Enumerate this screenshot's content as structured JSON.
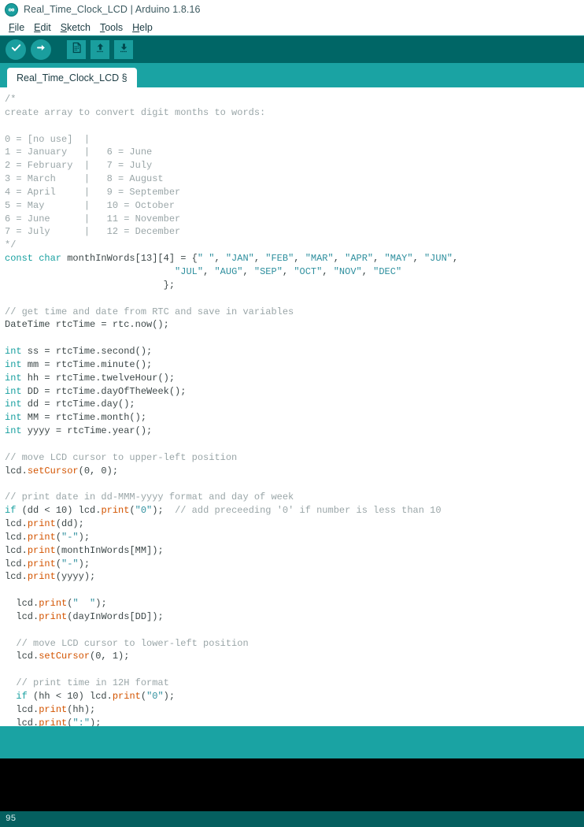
{
  "window": {
    "title": "Real_Time_Clock_LCD | Arduino 1.8.16",
    "logo_icon": "arduino-infinity-logo"
  },
  "menubar": {
    "items": [
      {
        "label": "File",
        "mnemonic": "F"
      },
      {
        "label": "Edit",
        "mnemonic": "E"
      },
      {
        "label": "Sketch",
        "mnemonic": "S"
      },
      {
        "label": "Tools",
        "mnemonic": "T"
      },
      {
        "label": "Help",
        "mnemonic": "H"
      }
    ]
  },
  "toolbar": {
    "buttons": [
      {
        "name": "verify-button",
        "icon": "checkmark-icon",
        "tooltip": "Verify"
      },
      {
        "name": "upload-button",
        "icon": "arrow-right-icon",
        "tooltip": "Upload"
      },
      {
        "name": "new-sketch-button",
        "icon": "new-file-icon",
        "tooltip": "New"
      },
      {
        "name": "open-sketch-button",
        "icon": "arrow-up-icon",
        "tooltip": "Open"
      },
      {
        "name": "save-sketch-button",
        "icon": "arrow-down-icon",
        "tooltip": "Save"
      }
    ]
  },
  "tabs": [
    {
      "label": "Real_Time_Clock_LCD §",
      "active": true
    }
  ],
  "editor": {
    "lines": [
      [
        {
          "t": "/*",
          "c": "cm"
        }
      ],
      [
        {
          "t": "create array to convert digit months to words:",
          "c": "cm"
        }
      ],
      [
        {
          "t": "",
          "c": "cm"
        }
      ],
      [
        {
          "t": "0 = [no use]  |",
          "c": "cm"
        }
      ],
      [
        {
          "t": "1 = January   |   6 = June",
          "c": "cm"
        }
      ],
      [
        {
          "t": "2 = February  |   7 = July",
          "c": "cm"
        }
      ],
      [
        {
          "t": "3 = March     |   8 = August",
          "c": "cm"
        }
      ],
      [
        {
          "t": "4 = April     |   9 = September",
          "c": "cm"
        }
      ],
      [
        {
          "t": "5 = May       |   10 = October",
          "c": "cm"
        }
      ],
      [
        {
          "t": "6 = June      |   11 = November",
          "c": "cm"
        }
      ],
      [
        {
          "t": "7 = July      |   12 = December",
          "c": "cm"
        }
      ],
      [
        {
          "t": "*/",
          "c": "cm"
        }
      ],
      [
        {
          "t": "const char",
          "c": "kw"
        },
        {
          "t": " monthInWords[13][4] = {",
          "c": "pl"
        },
        {
          "t": "\" \"",
          "c": "st"
        },
        {
          "t": ", ",
          "c": "pl"
        },
        {
          "t": "\"JAN\"",
          "c": "st"
        },
        {
          "t": ", ",
          "c": "pl"
        },
        {
          "t": "\"FEB\"",
          "c": "st"
        },
        {
          "t": ", ",
          "c": "pl"
        },
        {
          "t": "\"MAR\"",
          "c": "st"
        },
        {
          "t": ", ",
          "c": "pl"
        },
        {
          "t": "\"APR\"",
          "c": "st"
        },
        {
          "t": ", ",
          "c": "pl"
        },
        {
          "t": "\"MAY\"",
          "c": "st"
        },
        {
          "t": ", ",
          "c": "pl"
        },
        {
          "t": "\"JUN\"",
          "c": "st"
        },
        {
          "t": ",",
          "c": "pl"
        }
      ],
      [
        {
          "t": "                              ",
          "c": "pl"
        },
        {
          "t": "\"JUL\"",
          "c": "st"
        },
        {
          "t": ", ",
          "c": "pl"
        },
        {
          "t": "\"AUG\"",
          "c": "st"
        },
        {
          "t": ", ",
          "c": "pl"
        },
        {
          "t": "\"SEP\"",
          "c": "st"
        },
        {
          "t": ", ",
          "c": "pl"
        },
        {
          "t": "\"OCT\"",
          "c": "st"
        },
        {
          "t": ", ",
          "c": "pl"
        },
        {
          "t": "\"NOV\"",
          "c": "st"
        },
        {
          "t": ", ",
          "c": "pl"
        },
        {
          "t": "\"DEC\"",
          "c": "st"
        }
      ],
      [
        {
          "t": "                            };",
          "c": "pl"
        }
      ],
      [
        {
          "t": "",
          "c": "pl"
        }
      ],
      [
        {
          "t": "// get time and date from RTC and save in variables",
          "c": "cm"
        }
      ],
      [
        {
          "t": "DateTime rtcTime = rtc.now();",
          "c": "pl"
        }
      ],
      [
        {
          "t": "",
          "c": "pl"
        }
      ],
      [
        {
          "t": "int",
          "c": "kw"
        },
        {
          "t": " ss = rtcTime.second();",
          "c": "pl"
        }
      ],
      [
        {
          "t": "int",
          "c": "kw"
        },
        {
          "t": " mm = rtcTime.minute();",
          "c": "pl"
        }
      ],
      [
        {
          "t": "int",
          "c": "kw"
        },
        {
          "t": " hh = rtcTime.twelveHour();",
          "c": "pl"
        }
      ],
      [
        {
          "t": "int",
          "c": "kw"
        },
        {
          "t": " DD = rtcTime.dayOfTheWeek();",
          "c": "pl"
        }
      ],
      [
        {
          "t": "int",
          "c": "kw"
        },
        {
          "t": " dd = rtcTime.day();",
          "c": "pl"
        }
      ],
      [
        {
          "t": "int",
          "c": "kw"
        },
        {
          "t": " MM = rtcTime.month();",
          "c": "pl"
        }
      ],
      [
        {
          "t": "int",
          "c": "kw"
        },
        {
          "t": " yyyy = rtcTime.year();",
          "c": "pl"
        }
      ],
      [
        {
          "t": "",
          "c": "pl"
        }
      ],
      [
        {
          "t": "// move LCD cursor to upper-left position",
          "c": "cm"
        }
      ],
      [
        {
          "t": "lcd.",
          "c": "pl"
        },
        {
          "t": "setCursor",
          "c": "fn"
        },
        {
          "t": "(0, 0);",
          "c": "pl"
        }
      ],
      [
        {
          "t": "",
          "c": "pl"
        }
      ],
      [
        {
          "t": "// print date in dd-MMM-yyyy format and day of week",
          "c": "cm"
        }
      ],
      [
        {
          "t": "if",
          "c": "kw"
        },
        {
          "t": " (dd < 10) lcd.",
          "c": "pl"
        },
        {
          "t": "print",
          "c": "fn"
        },
        {
          "t": "(",
          "c": "pl"
        },
        {
          "t": "\"0\"",
          "c": "st"
        },
        {
          "t": ");  ",
          "c": "pl"
        },
        {
          "t": "// add preceeding '0' if number is less than 10",
          "c": "cm"
        }
      ],
      [
        {
          "t": "lcd.",
          "c": "pl"
        },
        {
          "t": "print",
          "c": "fn"
        },
        {
          "t": "(dd);",
          "c": "pl"
        }
      ],
      [
        {
          "t": "lcd.",
          "c": "pl"
        },
        {
          "t": "print",
          "c": "fn"
        },
        {
          "t": "(",
          "c": "pl"
        },
        {
          "t": "\"-\"",
          "c": "st"
        },
        {
          "t": ");",
          "c": "pl"
        }
      ],
      [
        {
          "t": "lcd.",
          "c": "pl"
        },
        {
          "t": "print",
          "c": "fn"
        },
        {
          "t": "(monthInWords[MM]);",
          "c": "pl"
        }
      ],
      [
        {
          "t": "lcd.",
          "c": "pl"
        },
        {
          "t": "print",
          "c": "fn"
        },
        {
          "t": "(",
          "c": "pl"
        },
        {
          "t": "\"-\"",
          "c": "st"
        },
        {
          "t": ");",
          "c": "pl"
        }
      ],
      [
        {
          "t": "lcd.",
          "c": "pl"
        },
        {
          "t": "print",
          "c": "fn"
        },
        {
          "t": "(yyyy);",
          "c": "pl"
        }
      ],
      [
        {
          "t": "",
          "c": "pl"
        }
      ],
      [
        {
          "t": "  lcd.",
          "c": "pl"
        },
        {
          "t": "print",
          "c": "fn"
        },
        {
          "t": "(",
          "c": "pl"
        },
        {
          "t": "\"  \"",
          "c": "st"
        },
        {
          "t": ");",
          "c": "pl"
        }
      ],
      [
        {
          "t": "  lcd.",
          "c": "pl"
        },
        {
          "t": "print",
          "c": "fn"
        },
        {
          "t": "(dayInWords[DD]);",
          "c": "pl"
        }
      ],
      [
        {
          "t": "",
          "c": "pl"
        }
      ],
      [
        {
          "t": "  // move LCD cursor to lower-left position",
          "c": "cm"
        }
      ],
      [
        {
          "t": "  lcd.",
          "c": "pl"
        },
        {
          "t": "setCursor",
          "c": "fn"
        },
        {
          "t": "(0, 1);",
          "c": "pl"
        }
      ],
      [
        {
          "t": "",
          "c": "pl"
        }
      ],
      [
        {
          "t": "  // print time in 12H format",
          "c": "cm"
        }
      ],
      [
        {
          "t": "  ",
          "c": "pl"
        },
        {
          "t": "if",
          "c": "kw"
        },
        {
          "t": " (hh < 10) lcd.",
          "c": "pl"
        },
        {
          "t": "print",
          "c": "fn"
        },
        {
          "t": "(",
          "c": "pl"
        },
        {
          "t": "\"0\"",
          "c": "st"
        },
        {
          "t": ");",
          "c": "pl"
        }
      ],
      [
        {
          "t": "  lcd.",
          "c": "pl"
        },
        {
          "t": "print",
          "c": "fn"
        },
        {
          "t": "(hh);",
          "c": "pl"
        }
      ],
      [
        {
          "t": "  lcd.",
          "c": "pl"
        },
        {
          "t": "print",
          "c": "fn"
        },
        {
          "t": "(",
          "c": "pl"
        },
        {
          "t": "\":\"",
          "c": "st"
        },
        {
          "t": ");",
          "c": "pl"
        }
      ]
    ]
  },
  "console": {
    "message_text": "",
    "output_text": ""
  },
  "statusbar": {
    "line_number": "95",
    "board_text": ""
  },
  "colors": {
    "toolbar_bg": "#006666",
    "tabbar_bg": "#1aa3a3",
    "statusbar_bg": "#055f5f",
    "console_bg": "#000000",
    "editor_bg": "#ffffff",
    "keyword": "#18a0a0",
    "function": "#d35400",
    "string": "#2e8f9e",
    "comment": "#9aa6a8",
    "plain_text": "#3c4748"
  }
}
